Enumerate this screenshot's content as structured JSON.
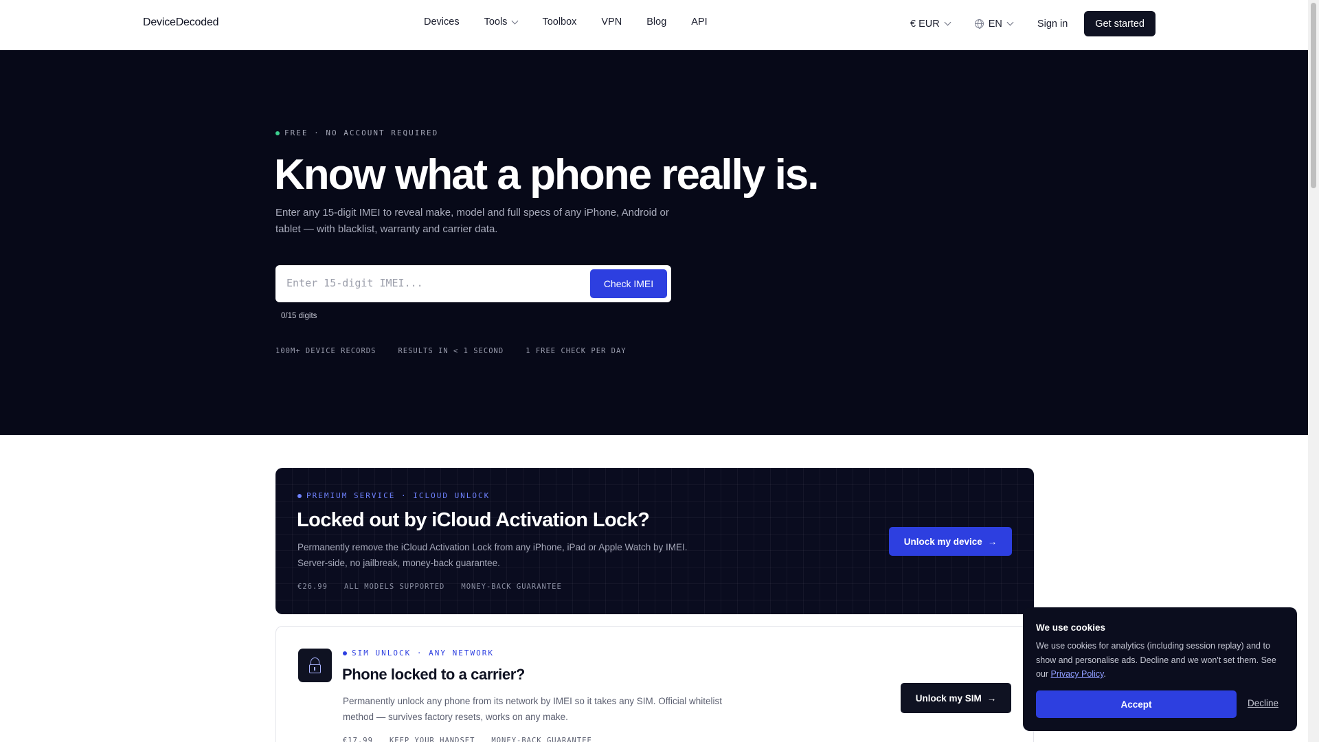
{
  "nav": {
    "logo": "DeviceDecoded",
    "links": [
      {
        "label": "Devices"
      },
      {
        "label": "Tools"
      },
      {
        "label": "Toolbox"
      },
      {
        "label": "VPN"
      },
      {
        "label": "Blog"
      },
      {
        "label": "API"
      }
    ],
    "currency": "€ EUR",
    "language": "EN",
    "signin": "Sign in",
    "get_started": "Get started"
  },
  "hero": {
    "eyebrow": "FREE · NO ACCOUNT REQUIRED",
    "eyebrow_dot_color": "#3ccf8e",
    "title": "Know what a phone really is.",
    "lead": "Enter any 15-digit IMEI to reveal make, model and full specs of any iPhone, Android or tablet — with blacklist, warranty and carrier data.",
    "imei_placeholder": "Enter 15-digit IMEI...",
    "imei_value": "",
    "check_button": "Check IMEI",
    "digit_counter": "0/15 digits",
    "stats": [
      "100M+ DEVICE RECORDS",
      "RESULTS IN < 1 SECOND",
      "1 FREE CHECK PER DAY"
    ]
  },
  "icloud_card": {
    "tag": "PREMIUM SERVICE · ICLOUD UNLOCK",
    "title": "Locked out by iCloud Activation Lock?",
    "description": "Permanently remove the iCloud Activation Lock from any iPhone, iPad or Apple Watch by IMEI. Server-side, no jailbreak, money-back guarantee.",
    "meta": [
      "€26.99",
      "ALL MODELS SUPPORTED",
      "MONEY-BACK GUARANTEE"
    ],
    "button": "Unlock my device"
  },
  "sim_card": {
    "tag": "SIM UNLOCK · ANY NETWORK",
    "title": "Phone locked to a carrier?",
    "description": "Permanently unlock any phone from its network by IMEI so it takes any SIM. Official whitelist method — survives factory resets, works on any make.",
    "meta": [
      "€17.99",
      "KEEP YOUR HANDSET",
      "MONEY-BACK GUARANTEE"
    ],
    "button": "Unlock my SIM",
    "icon": "lock-icon"
  },
  "cookie": {
    "title": "We use cookies",
    "text_before_link": "We use cookies for analytics (including session replay) and to show and personalise ads. Decline and we won't set them. See our ",
    "link": "Privacy Policy",
    "text_after_link": ".",
    "accept": "Accept",
    "decline": "Decline"
  },
  "colors": {
    "accent": "#2d3fe0",
    "dark": "#070918",
    "ink": "#0f1222"
  }
}
